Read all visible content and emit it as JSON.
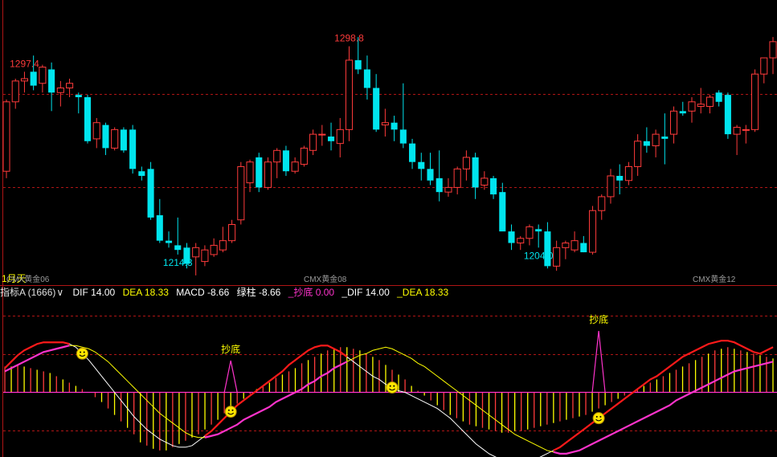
{
  "indicator_bar": {
    "name": "指标A (1666)",
    "dropdown_glyph": "∨",
    "dif": "DIF 14.00",
    "dea": "DEA 18.33",
    "macd": "MACD -8.66",
    "lvzhu": "绿柱 -8.66",
    "chaodi": "_抄底 0.00",
    "dif2": "_DIF 14.00",
    "dea2": "_DEA 18.33"
  },
  "colors": {
    "background": "#000000",
    "up": "#ff3b3b",
    "down": "#00e5ee",
    "grid": "#b01515",
    "dif": "#ffffff",
    "dea": "#ffff00",
    "pink": "#ff33cc",
    "red_line": "#ff1a1a",
    "label_yellow": "#ffff00"
  },
  "chart_data": [
    {
      "type": "candlestick",
      "title": "",
      "contract_labels": [
        "1月天",
        "CMX黄金06",
        "CMX黄金08",
        "CMX黄金12"
      ],
      "annotations": [
        {
          "text": "1297.4",
          "kind": "high",
          "index": 2
        },
        {
          "text": "1214.3",
          "kind": "low",
          "index": 19
        },
        {
          "text": "1298.8",
          "kind": "high",
          "index": 38
        },
        {
          "text": "1204.0",
          "kind": "low",
          "index": 59
        }
      ],
      "ylim": [
        1198,
        1316
      ],
      "candles": [
        [
          1242,
          1273,
          1239,
          1272
        ],
        [
          1272,
          1282,
          1269,
          1281
        ],
        [
          1281,
          1285,
          1276,
          1282
        ],
        [
          1285,
          1292,
          1277,
          1279
        ],
        [
          1280,
          1288,
          1276,
          1287
        ],
        [
          1286,
          1289,
          1268,
          1276
        ],
        [
          1276,
          1281,
          1270,
          1278
        ],
        [
          1278,
          1282,
          1274,
          1280
        ],
        [
          1275,
          1276,
          1267,
          1274
        ],
        [
          1274,
          1275,
          1254,
          1255
        ],
        [
          1256,
          1265,
          1252,
          1263
        ],
        [
          1262,
          1263,
          1249,
          1252
        ],
        [
          1252,
          1261,
          1251,
          1260
        ],
        [
          1260,
          1261,
          1250,
          1251
        ],
        [
          1260,
          1262,
          1241,
          1243
        ],
        [
          1242,
          1244,
          1238,
          1240
        ],
        [
          1243,
          1246,
          1221,
          1222
        ],
        [
          1223,
          1230,
          1211,
          1212
        ],
        [
          1212,
          1216,
          1209,
          1211
        ],
        [
          1210,
          1222,
          1206,
          1208
        ],
        [
          1209,
          1211,
          1200,
          1202
        ],
        [
          1205,
          1211,
          1197,
          1209
        ],
        [
          1203,
          1210,
          1201,
          1208
        ],
        [
          1206,
          1213,
          1205,
          1210
        ],
        [
          1208,
          1218,
          1207,
          1212
        ],
        [
          1212,
          1221,
          1211,
          1219
        ],
        [
          1221,
          1246,
          1219,
          1244
        ],
        [
          1237,
          1247,
          1233,
          1246
        ],
        [
          1248,
          1250,
          1233,
          1235
        ],
        [
          1235,
          1248,
          1234,
          1246
        ],
        [
          1246,
          1252,
          1239,
          1251
        ],
        [
          1251,
          1253,
          1240,
          1242
        ],
        [
          1242,
          1248,
          1241,
          1246
        ],
        [
          1245,
          1253,
          1244,
          1252
        ],
        [
          1251,
          1260,
          1249,
          1258
        ],
        [
          1258,
          1262,
          1253,
          1258
        ],
        [
          1257,
          1263,
          1251,
          1255
        ],
        [
          1254,
          1265,
          1248,
          1260
        ],
        [
          1260,
          1296,
          1255,
          1290
        ],
        [
          1290,
          1300,
          1284,
          1286
        ],
        [
          1286,
          1292,
          1273,
          1278
        ],
        [
          1278,
          1284,
          1259,
          1260
        ],
        [
          1262,
          1269,
          1257,
          1263
        ],
        [
          1263,
          1266,
          1255,
          1260
        ],
        [
          1260,
          1280,
          1252,
          1254
        ],
        [
          1254,
          1256,
          1243,
          1246
        ],
        [
          1246,
          1250,
          1238,
          1243
        ],
        [
          1243,
          1250,
          1236,
          1238
        ],
        [
          1239,
          1251,
          1229,
          1233
        ],
        [
          1233,
          1239,
          1231,
          1235
        ],
        [
          1235,
          1244,
          1232,
          1243
        ],
        [
          1243,
          1251,
          1238,
          1248
        ],
        [
          1248,
          1250,
          1230,
          1235
        ],
        [
          1236,
          1242,
          1234,
          1239
        ],
        [
          1239,
          1240,
          1230,
          1232
        ],
        [
          1233,
          1237,
          1217,
          1216
        ],
        [
          1216,
          1219,
          1208,
          1211
        ],
        [
          1211,
          1214,
          1208,
          1213
        ],
        [
          1213,
          1219,
          1210,
          1218
        ],
        [
          1217,
          1219,
          1209,
          1216
        ],
        [
          1216,
          1220,
          1200,
          1201
        ],
        [
          1201,
          1212,
          1199,
          1209
        ],
        [
          1209,
          1212,
          1204,
          1211
        ],
        [
          1208,
          1216,
          1207,
          1212
        ],
        [
          1211,
          1214,
          1207,
          1207
        ],
        [
          1207,
          1227,
          1206,
          1225
        ],
        [
          1225,
          1232,
          1221,
          1231
        ],
        [
          1231,
          1243,
          1228,
          1240
        ],
        [
          1240,
          1245,
          1232,
          1238
        ],
        [
          1238,
          1246,
          1236,
          1244
        ],
        [
          1244,
          1258,
          1240,
          1255
        ],
        [
          1255,
          1261,
          1250,
          1253
        ],
        [
          1253,
          1260,
          1248,
          1258
        ],
        [
          1257,
          1267,
          1245,
          1256
        ],
        [
          1258,
          1270,
          1254,
          1268
        ],
        [
          1268,
          1272,
          1266,
          1267
        ],
        [
          1268,
          1274,
          1263,
          1272
        ],
        [
          1270,
          1278,
          1267,
          1271
        ],
        [
          1270,
          1275,
          1267,
          1274
        ],
        [
          1276,
          1277,
          1270,
          1272
        ],
        [
          1275,
          1276,
          1256,
          1258
        ],
        [
          1258,
          1262,
          1249,
          1261
        ],
        [
          1260,
          1262,
          1254,
          1260
        ],
        [
          1260,
          1286,
          1259,
          1284
        ],
        [
          1284,
          1291,
          1280,
          1291
        ],
        [
          1291,
          1300,
          1284,
          1298
        ]
      ]
    },
    {
      "type": "macd",
      "title": "",
      "legend": [
        "DIF",
        "DEA",
        "MACD",
        "_抄底",
        "_DIF",
        "_DEA"
      ],
      "signal_labels": [
        {
          "text": "抄底",
          "index": 35
        },
        {
          "text": "抄底",
          "index": 92
        }
      ],
      "smiley_marks": [
        {
          "index": 12,
          "on": "dif"
        },
        {
          "index": 35,
          "on": "dif"
        },
        {
          "index": 60,
          "on": "dif"
        },
        {
          "index": 92,
          "on": "dif"
        }
      ],
      "ylim": [
        -50,
        55
      ],
      "histogram": [
        16,
        16,
        17,
        16,
        15,
        14,
        13,
        12,
        10,
        8,
        6,
        4,
        2,
        0,
        -3,
        -6,
        -10,
        -14,
        -18,
        -22,
        -26,
        -31,
        -33,
        -35,
        -36,
        -36,
        -34,
        -32,
        -30,
        -28,
        -26,
        -23,
        -20,
        -17,
        -13,
        -10,
        -7,
        -4,
        -1,
        2,
        4,
        6,
        9,
        11,
        13,
        15,
        18,
        20,
        22,
        24,
        26,
        27,
        28,
        28,
        27,
        26,
        24,
        22,
        20,
        17,
        14,
        11,
        8,
        4,
        1,
        -2,
        -5,
        -8,
        -11,
        -14,
        -16,
        -18,
        -20,
        -21,
        -22,
        -23,
        -24,
        -25,
        -25,
        -24,
        -24,
        -23,
        -22,
        -21,
        -20,
        -19,
        -18,
        -17,
        -16,
        -15,
        -14,
        -12,
        -10,
        -8,
        -6,
        -4,
        -2,
        0,
        2,
        4,
        6,
        8,
        10,
        12,
        14,
        16,
        18,
        20,
        22,
        24,
        26,
        27,
        28,
        27,
        26,
        25,
        24,
        23,
        22,
        21
      ],
      "dif": [
        15,
        19,
        23,
        26,
        28,
        30,
        31,
        31,
        31,
        31,
        30,
        28,
        24,
        20,
        15,
        10,
        5,
        0,
        -5,
        -10,
        -15,
        -19,
        -23,
        -26,
        -29,
        -31,
        -33,
        -34,
        -34,
        -33,
        -30,
        -27,
        -24,
        -20,
        -16,
        -12,
        -8,
        -5,
        -2,
        1,
        4,
        7,
        10,
        13,
        17,
        20,
        23,
        26,
        28,
        29,
        29,
        27,
        25,
        22,
        19,
        16,
        13,
        10,
        8,
        5,
        3,
        1,
        0,
        -2,
        -4,
        -6,
        -8,
        -10,
        -13,
        -16,
        -20,
        -24,
        -28,
        -32,
        -35,
        -38,
        -40,
        -42,
        -43,
        -44,
        -44,
        -43,
        -42,
        -40,
        -38,
        -36,
        -34,
        -31,
        -28,
        -25,
        -22,
        -19,
        -16,
        -13,
        -10,
        -7,
        -4,
        -1,
        2,
        5,
        8,
        10,
        13,
        16,
        19,
        22,
        24,
        26,
        28,
        30,
        31,
        32,
        32,
        31,
        29,
        27,
        25,
        24,
        26,
        28
      ],
      "dea": [
        13,
        15,
        17,
        19,
        21,
        23,
        25,
        26,
        27,
        28,
        29,
        29,
        28,
        27,
        25,
        22,
        19,
        15,
        11,
        7,
        3,
        -1,
        -5,
        -9,
        -13,
        -16,
        -19,
        -22,
        -25,
        -27,
        -28,
        -28,
        -27,
        -26,
        -24,
        -22,
        -20,
        -17,
        -15,
        -13,
        -11,
        -9,
        -6,
        -4,
        -2,
        0,
        2,
        5,
        7,
        10,
        12,
        15,
        17,
        19,
        21,
        23,
        24,
        26,
        27,
        28,
        27,
        25,
        23,
        21,
        18,
        16,
        13,
        10,
        7,
        4,
        1,
        -2,
        -5,
        -8,
        -11,
        -14,
        -17,
        -20,
        -23,
        -26,
        -28,
        -30,
        -32,
        -34,
        -36,
        -37,
        -38,
        -38,
        -37,
        -36,
        -34,
        -32,
        -30,
        -28,
        -26,
        -24,
        -22,
        -20,
        -18,
        -16,
        -14,
        -12,
        -10,
        -8,
        -5,
        -3,
        -1,
        1,
        3,
        5,
        7,
        9,
        11,
        13,
        14,
        15,
        16,
        17,
        18,
        19
      ]
    }
  ]
}
